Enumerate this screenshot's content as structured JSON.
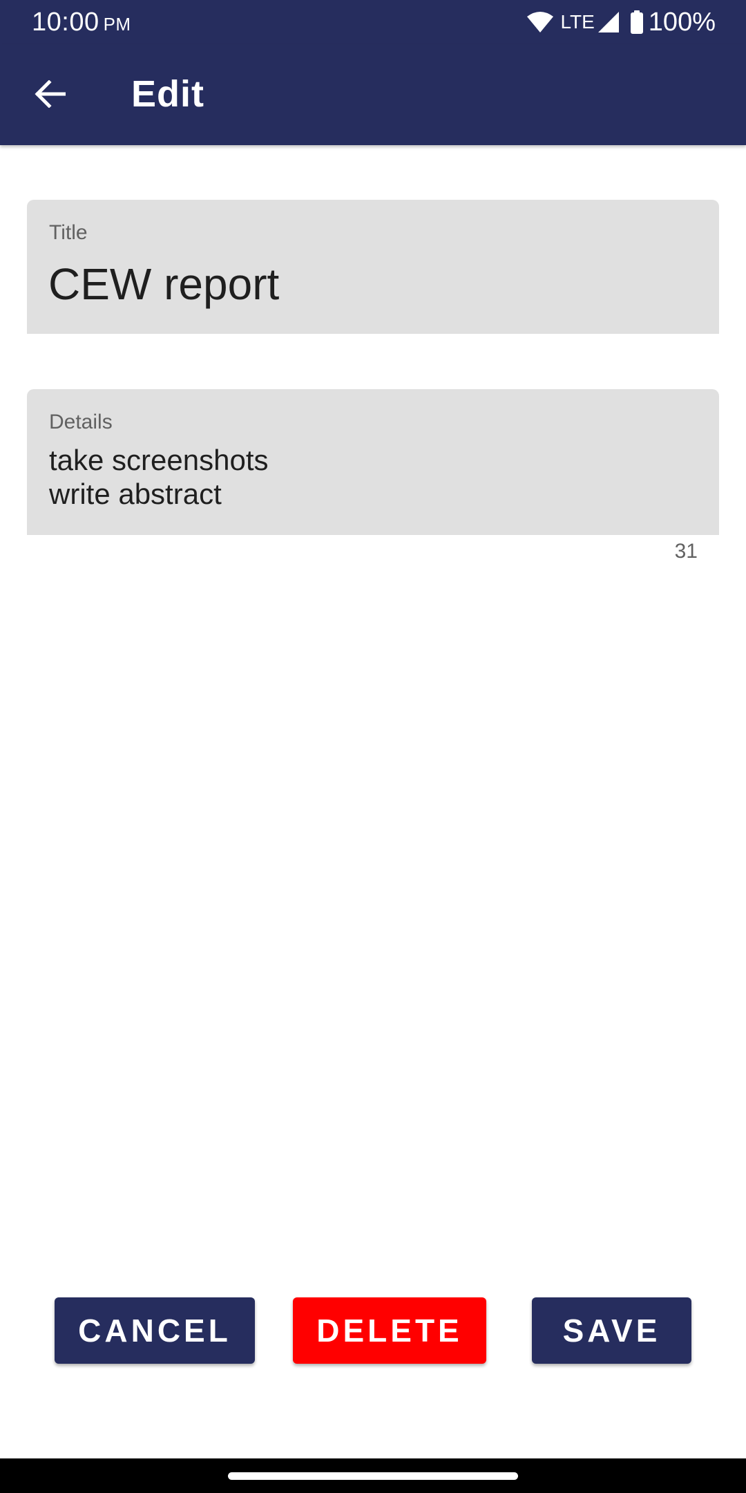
{
  "status_bar": {
    "time": "10:00",
    "ampm": "PM",
    "network": "LTE",
    "battery": "100%"
  },
  "app_bar": {
    "title": "Edit",
    "back_icon": "arrow-back-icon"
  },
  "form": {
    "title_field": {
      "label": "Title",
      "value": "CEW report"
    },
    "details_field": {
      "label": "Details",
      "lines": [
        "take screenshots",
        "write abstract"
      ],
      "char_count": "31"
    }
  },
  "actions": {
    "cancel_label": "CANCEL",
    "delete_label": "DELETE",
    "save_label": "SAVE"
  },
  "colors": {
    "primary": "#262d5e",
    "danger": "#ff0000",
    "field_bg": "#e0e0e0"
  }
}
